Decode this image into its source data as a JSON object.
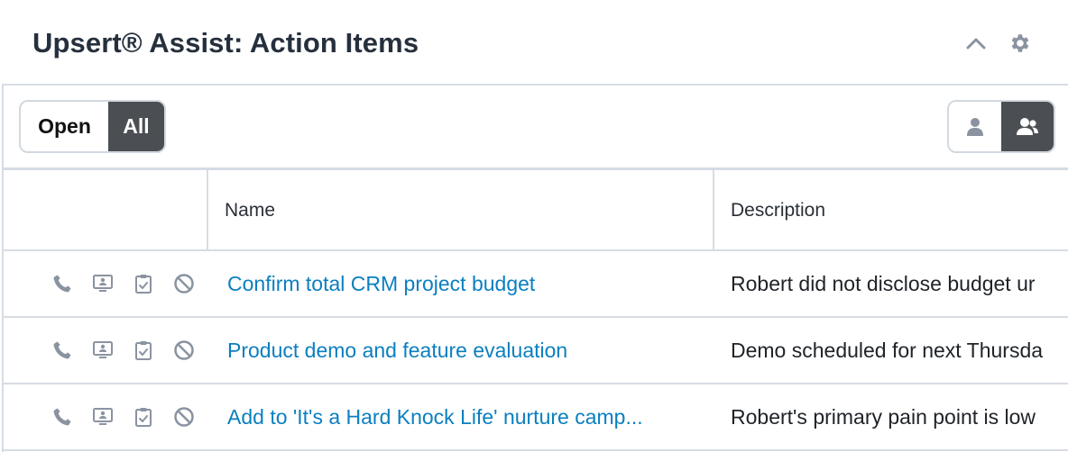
{
  "header": {
    "title": "Upsert® Assist: Action Items"
  },
  "toolbar": {
    "filter_open_label": "Open",
    "filter_all_label": "All",
    "selected_filter": "All",
    "selected_view": "team"
  },
  "table": {
    "columns": [
      "",
      "Name",
      "Description"
    ],
    "rows": [
      {
        "name": "Confirm total CRM project budget",
        "description": "Robert did not disclose budget ur"
      },
      {
        "name": "Product demo and feature evaluation",
        "description": "Demo scheduled for next Thursda"
      },
      {
        "name": "Add to 'It's a Hard Knock Life' nurture camp...",
        "description": "Robert's primary pain point is low"
      }
    ],
    "row_action_icons": [
      "phone-icon",
      "monitor-icon",
      "clipboard-check-icon",
      "ban-icon"
    ]
  },
  "colors": {
    "link": "#0b7fc0",
    "toggle_active_bg": "#4b4f54",
    "icon_gray": "#8a93a0",
    "border": "#d7dce3"
  }
}
